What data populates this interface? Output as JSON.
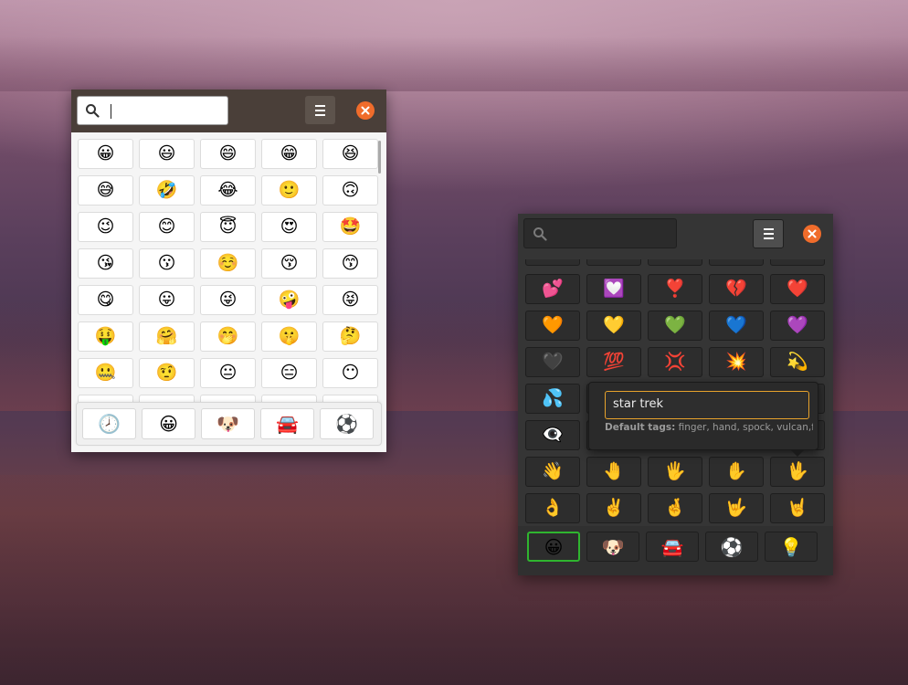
{
  "light_window": {
    "search": {
      "value": "",
      "placeholder": ""
    },
    "grid": [
      [
        "😀",
        "😃",
        "😄",
        "😁",
        "😆"
      ],
      [
        "😅",
        "🤣",
        "😂",
        "🙂",
        "🙃"
      ],
      [
        "😉",
        "😊",
        "😇",
        "😍",
        "🤩"
      ],
      [
        "😘",
        "😗",
        "☺️",
        "😚",
        "😙"
      ],
      [
        "😋",
        "😛",
        "😜",
        "🤪",
        "😝"
      ],
      [
        "🤑",
        "🤗",
        "🤭",
        "🤫",
        "🤔"
      ],
      [
        "🤐",
        "🤨",
        "😐",
        "😑",
        "😶"
      ]
    ],
    "categories": [
      "🕗",
      "😀",
      "🐶",
      "🚘",
      "⚽"
    ]
  },
  "dark_window": {
    "search": {
      "value": "",
      "placeholder": ""
    },
    "grid": [
      [
        "💕",
        "💟",
        "❣️",
        "💔",
        "❤️"
      ],
      [
        "🧡",
        "💛",
        "💚",
        "💙",
        "💜"
      ],
      [
        "🖤",
        "💯",
        "💢",
        "💥",
        "💫"
      ],
      [
        "💦",
        "",
        "",
        "",
        ""
      ],
      [
        "👁️‍🗨️",
        "",
        "",
        "",
        ""
      ],
      [
        "👋",
        "🤚",
        "🖐️",
        "✋",
        "🖖"
      ],
      [
        "👌",
        "✌️",
        "🤞",
        "🤟",
        "🤘"
      ]
    ],
    "categories": [
      "😀",
      "🐶",
      "🚘",
      "⚽",
      "💡"
    ],
    "active_category": 0
  },
  "tag_popover": {
    "value": "star trek",
    "default_tags_label": "Default tags:",
    "default_tags": "finger, hand, spock, vulcan,fi..."
  },
  "colors": {
    "close_button": "#f06c2b",
    "active_category_border": "#2fb52f",
    "entry_focus": "#e8a32c"
  },
  "icons": {
    "search": "magnifier-icon",
    "menu": "hamburger-menu-icon",
    "close": "close-icon"
  }
}
